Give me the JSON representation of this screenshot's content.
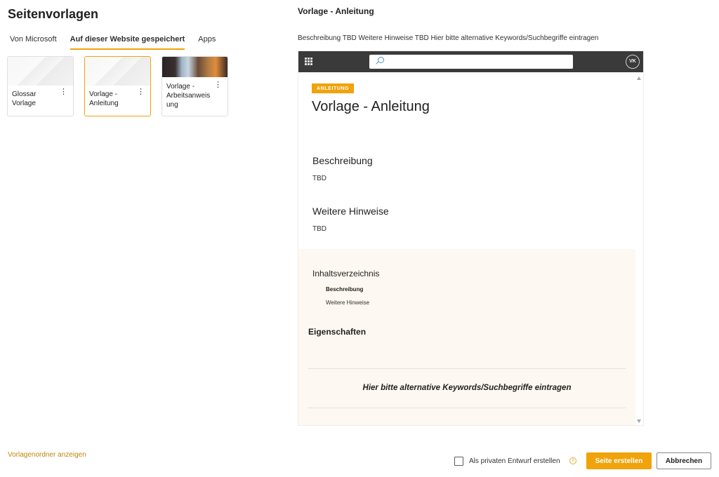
{
  "panel": {
    "title": "Seitenvorlagen",
    "tabs": [
      {
        "label": "Von Microsoft"
      },
      {
        "label": "Auf dieser Website gespeichert"
      },
      {
        "label": "Apps"
      }
    ],
    "selected_tab": "Auf dieser Website gespeichert",
    "templates": [
      {
        "name": "Glossar Vorlage",
        "more_icon": "more-vertical-icon"
      },
      {
        "name": "Vorlage - Anleitung",
        "more_icon": "more-vertical-icon"
      },
      {
        "name": "Vorlage - Arbeitsanweis ung",
        "more_icon": "more-vertical-icon"
      }
    ],
    "selected_template": "Vorlage - Anleitung",
    "folder_link": "Vorlagenordner anzeigen"
  },
  "preview": {
    "title": "Vorlage - Anleitung",
    "description": "Beschreibung TBD Weitere Hinweise TBD Hier bitte alternative Keywords/Suchbegriffe eintragen",
    "suitebar": {
      "app_launcher_icon": "waffle-icon",
      "search_icon": "search-icon",
      "avatar_initials": "VK"
    },
    "page": {
      "badge": "ANLEITUNG",
      "heading": "Vorlage - Anleitung",
      "sections": [
        {
          "heading": "Beschreibung",
          "text": "TBD"
        },
        {
          "heading": "Weitere Hinweise",
          "text": "TBD"
        }
      ],
      "toc": {
        "heading": "Inhaltsverzeichnis",
        "items": [
          "Beschreibung",
          "Weitere Hinweise"
        ]
      },
      "properties_heading": "Eigenschaften",
      "keywords_text": "Hier bitte alternative Keywords/Suchbegriffe eintragen"
    }
  },
  "footer": {
    "private_draft_label": "Als privaten Entwurf erstellen",
    "private_draft_checked": false,
    "info_icon": "info-icon",
    "create_button": "Seite erstellen",
    "cancel_button": "Abbrechen"
  },
  "colors": {
    "accent": "#f0a30a",
    "suitebar": "#3a3a3a",
    "band": "#fdf8f1"
  }
}
